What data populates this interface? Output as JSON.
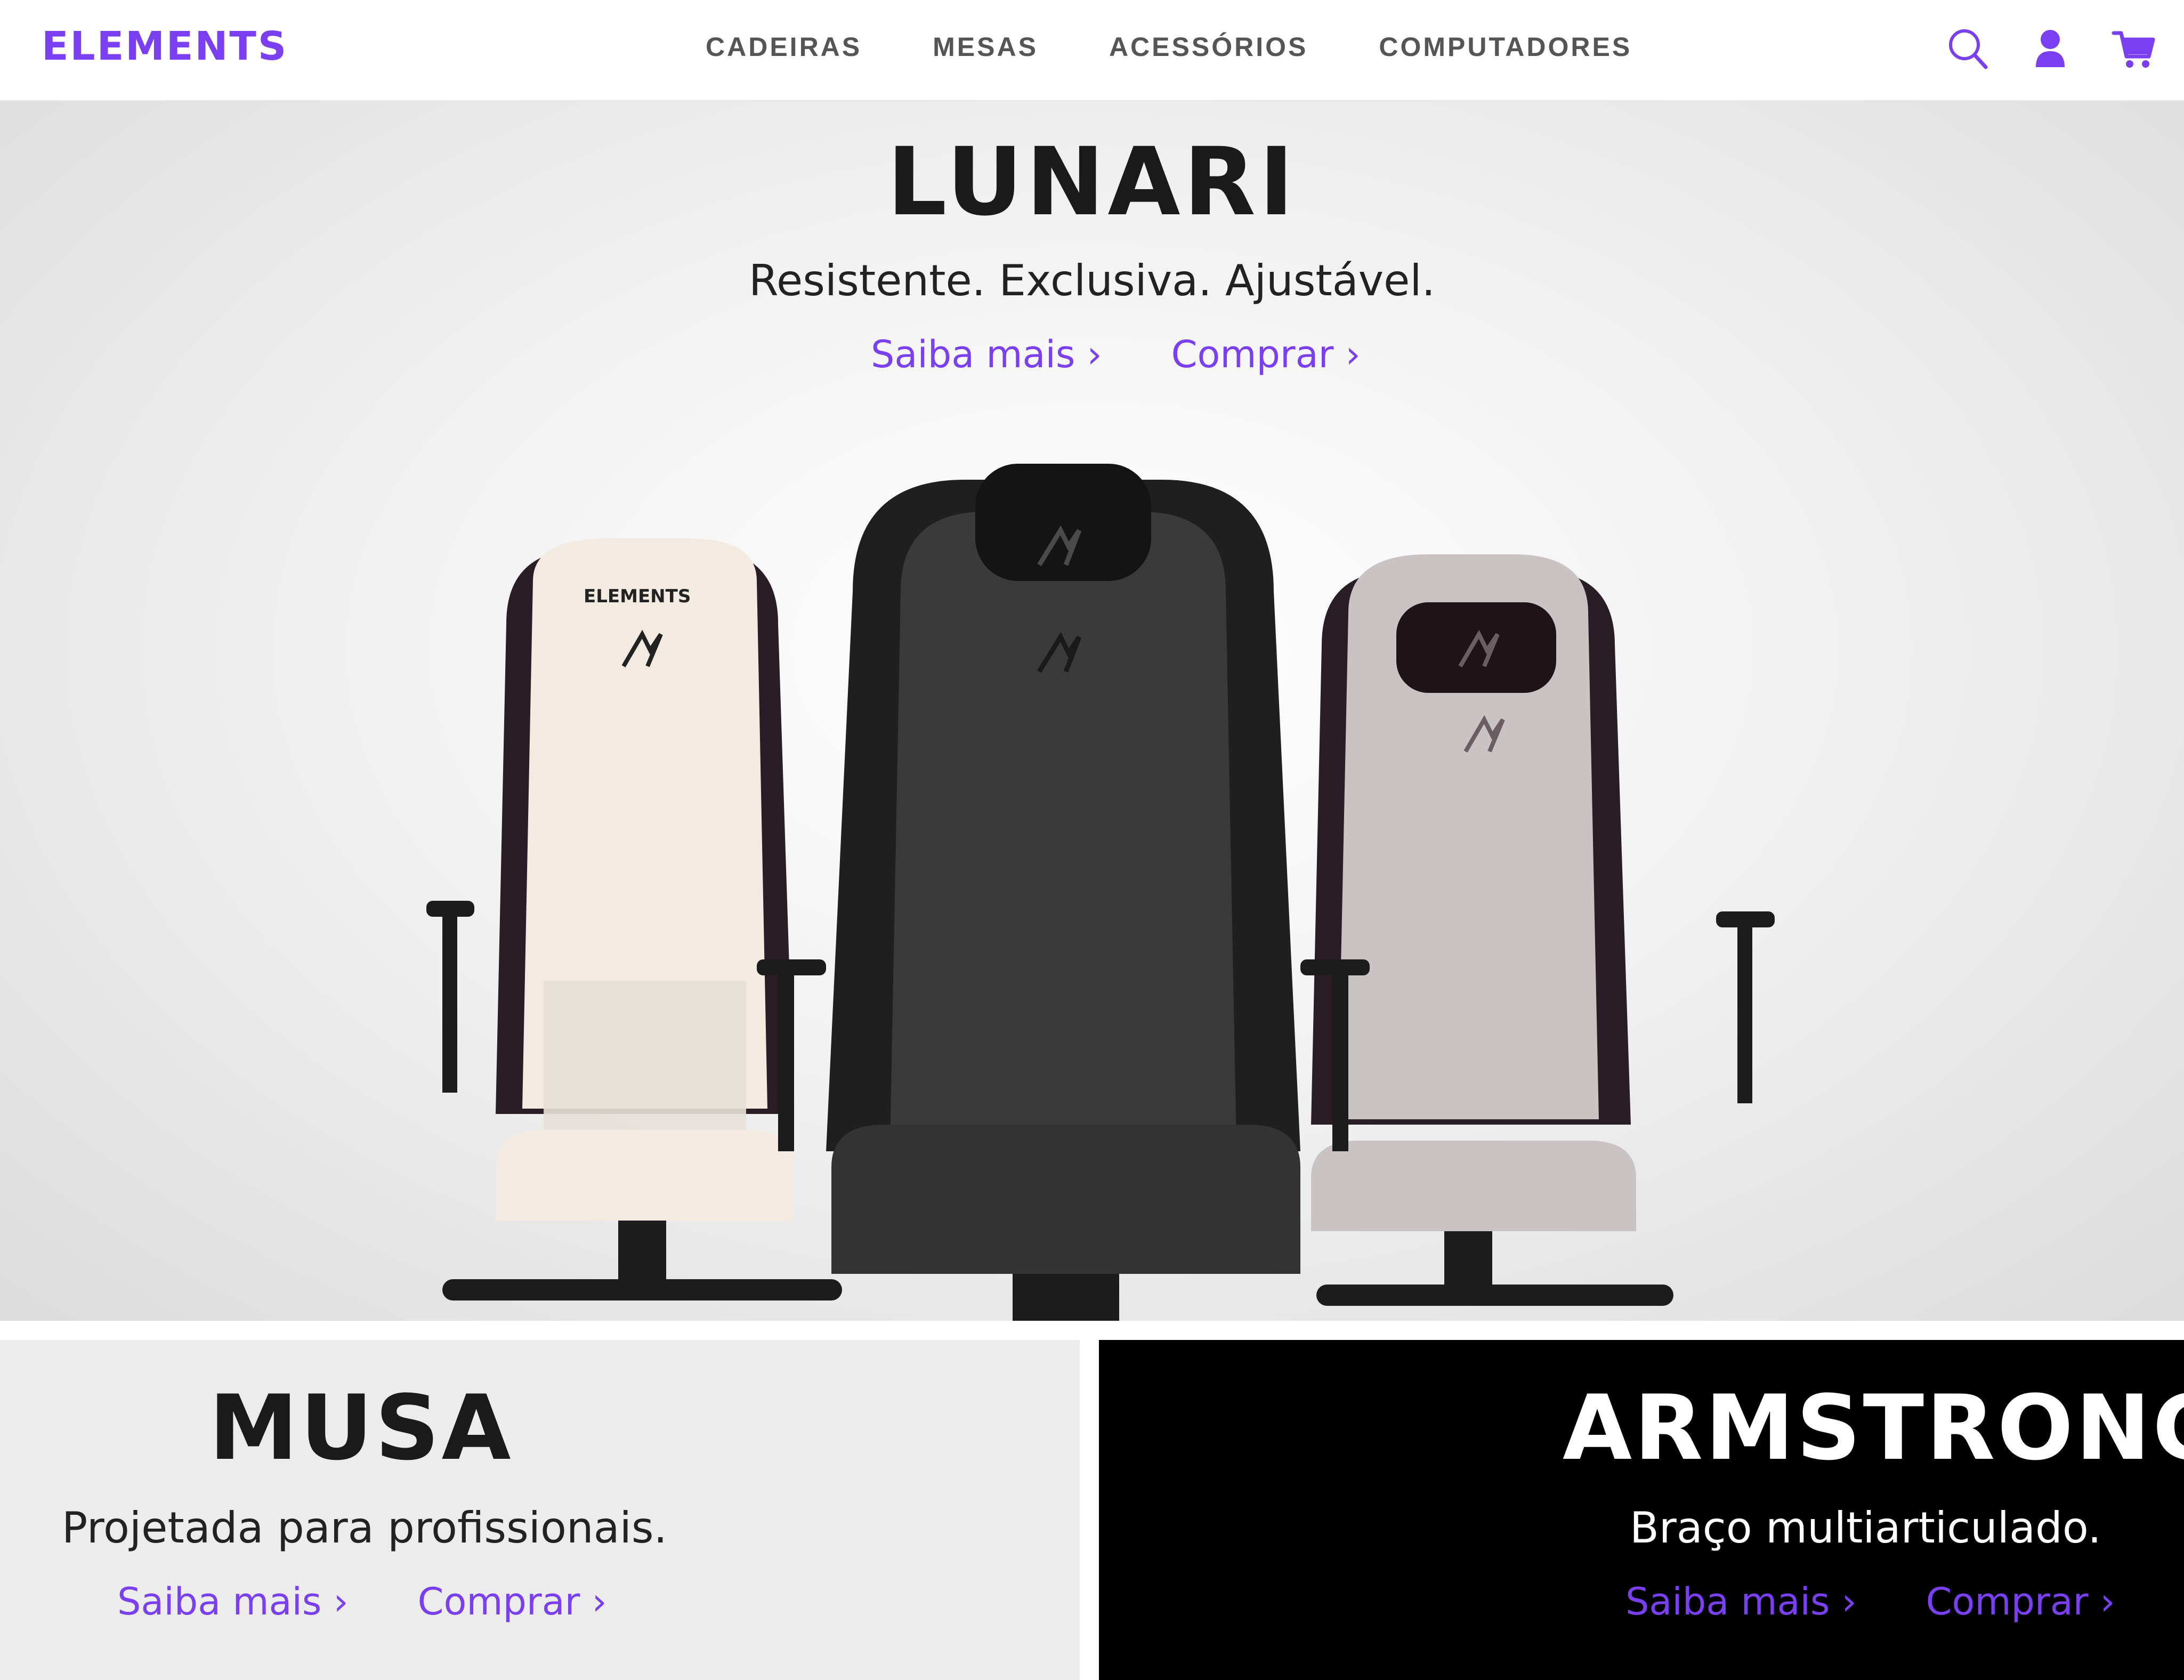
{
  "brand": {
    "logo": "ELEMENTS",
    "accent": "#7b3ff2"
  },
  "nav": {
    "items": [
      "CADEIRAS",
      "MESAS",
      "ACESSÓRIOS",
      "COMPUTADORES"
    ]
  },
  "header_icons": [
    "search-icon",
    "account-icon",
    "cart-icon"
  ],
  "hero": {
    "title": "LUNARI",
    "subtitle": "Resistente. Exclusiva. Ajustável.",
    "learn_more": "Saiba mais ›",
    "buy": "Comprar ›",
    "chair_backrest_label": "ELEMENTS"
  },
  "panels": [
    {
      "title": "MUSA",
      "subtitle": "Projetada para profissionais.",
      "learn_more": "Saiba mais ›",
      "buy": "Comprar ›",
      "background": "#ececec"
    },
    {
      "title": "ARMSTRONG",
      "subtitle": "Braço multiarticulado.",
      "learn_more": "Saiba mais ›",
      "buy": "Comprar ›",
      "background": "#000000"
    }
  ]
}
